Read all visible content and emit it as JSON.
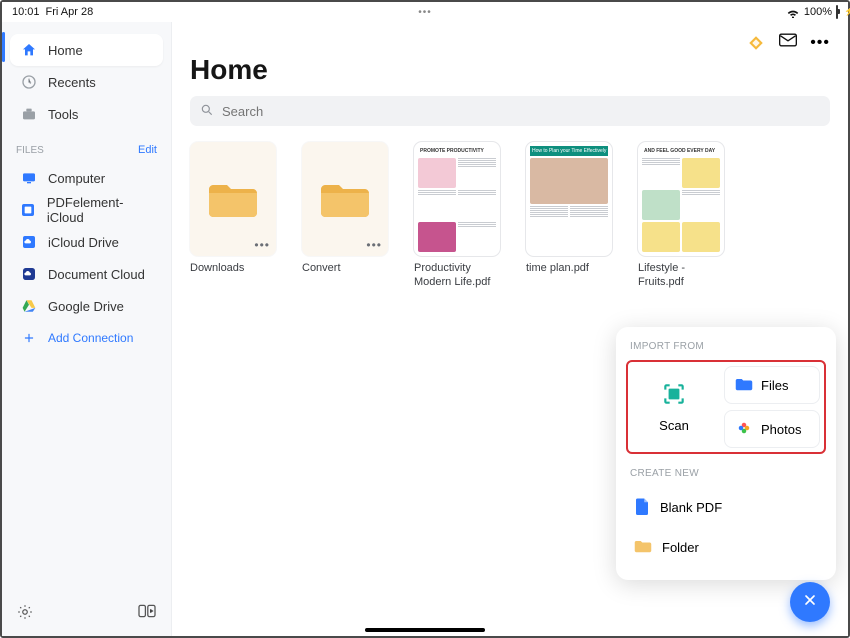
{
  "status": {
    "time": "10:01",
    "date": "Fri Apr 28",
    "center_dots": "•••",
    "battery_pct": "100%"
  },
  "topbar": {
    "diamond_alt": "premium-badge",
    "mail_alt": "inbox",
    "more_alt": "more"
  },
  "sidebar": {
    "nav": [
      {
        "key": "home",
        "label": "Home",
        "icon": "home-icon",
        "active": true
      },
      {
        "key": "recents",
        "label": "Recents",
        "icon": "clock-icon",
        "active": false
      },
      {
        "key": "tools",
        "label": "Tools",
        "icon": "toolbox-icon",
        "active": false
      }
    ],
    "files_header": "FILES",
    "edit_label": "Edit",
    "locations": [
      {
        "key": "computer",
        "label": "Computer",
        "icon": "monitor-icon"
      },
      {
        "key": "pdfe",
        "label": "PDFelement-iCloud",
        "icon": "pdf-app-icon"
      },
      {
        "key": "icloud",
        "label": "iCloud Drive",
        "icon": "icloud-icon"
      },
      {
        "key": "doccloud",
        "label": "Document Cloud",
        "icon": "cloud-square-icon"
      },
      {
        "key": "gdrive",
        "label": "Google Drive",
        "icon": "gdrive-icon"
      }
    ],
    "add_connection": "Add Connection"
  },
  "page": {
    "title": "Home",
    "search_placeholder": "Search"
  },
  "items": [
    {
      "kind": "folder",
      "caption": "Downloads"
    },
    {
      "kind": "folder",
      "caption": "Convert"
    },
    {
      "kind": "doc",
      "caption": "Productivity Modern Life.pdf",
      "head": "PROMOTE PRODUCTIVITY"
    },
    {
      "kind": "doc",
      "caption": "time plan.pdf",
      "head": "How to Plan your Time Effectively"
    },
    {
      "kind": "doc",
      "caption": "Lifestyle - Fruits.pdf",
      "head": "AND FEEL GOOD EVERY DAY"
    }
  ],
  "popup": {
    "import_label": "IMPORT FROM",
    "scan": "Scan",
    "files": "Files",
    "photos": "Photos",
    "create_label": "CREATE NEW",
    "blank_pdf": "Blank PDF",
    "folder": "Folder"
  }
}
